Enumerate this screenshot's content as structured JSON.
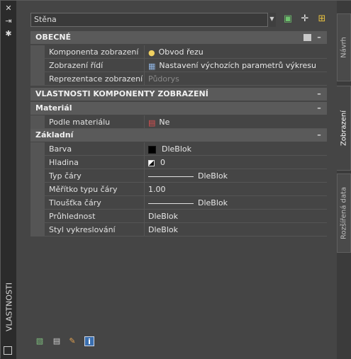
{
  "palette": {
    "title": "VLASTNOSTI",
    "close_icon": "close-icon",
    "pin_icon": "autohide-icon",
    "settings_icon": "gear-icon"
  },
  "selector": {
    "value": "Stěna",
    "tools": [
      "quick-select-icon",
      "pick-object-icon",
      "toggle-pickadd-icon"
    ]
  },
  "sections": {
    "general": {
      "title": "OBECNÉ",
      "rows": [
        {
          "name": "Komponenta zobrazení",
          "value": "Obvod řezu",
          "icon": "lightbulb-icon"
        },
        {
          "name": "Zobrazení řídí",
          "value": "Nastavení výchozích parametrů výkresu",
          "icon": "drawing-settings-icon"
        },
        {
          "name": "Reprezentace zobrazení",
          "value": "Půdorys",
          "dim": true
        }
      ]
    },
    "display_props": {
      "title": "VLASTNOSTI KOMPONENTY ZOBRAZENÍ"
    },
    "material": {
      "title": "Materiál",
      "rows": [
        {
          "name": "Podle materiálu",
          "value": "Ne",
          "icon": "material-icon"
        }
      ]
    },
    "basic": {
      "title": "Základní",
      "rows": [
        {
          "name": "Barva",
          "value": "DleBlok",
          "icon": "color-swatch-icon"
        },
        {
          "name": "Hladina",
          "value": "0",
          "icon": "layer-icon"
        },
        {
          "name": "Typ čáry",
          "value": "DleBlok",
          "icon": "linetype-icon"
        },
        {
          "name": "Měřítko typu čáry",
          "value": "1.00"
        },
        {
          "name": "Tloušťka čáry",
          "value": "DleBlok",
          "icon": "lineweight-icon"
        },
        {
          "name": "Průhlednost",
          "value": "DleBlok"
        },
        {
          "name": "Styl vykreslování",
          "value": "DleBlok"
        }
      ]
    }
  },
  "tabs": [
    {
      "label": "Návrh"
    },
    {
      "label": "Zobrazení"
    },
    {
      "label": "Rozšířená data"
    }
  ],
  "bottom_tools": [
    "select-objects-icon",
    "edit-style-icon",
    "match-properties-icon",
    "info-icon"
  ]
}
